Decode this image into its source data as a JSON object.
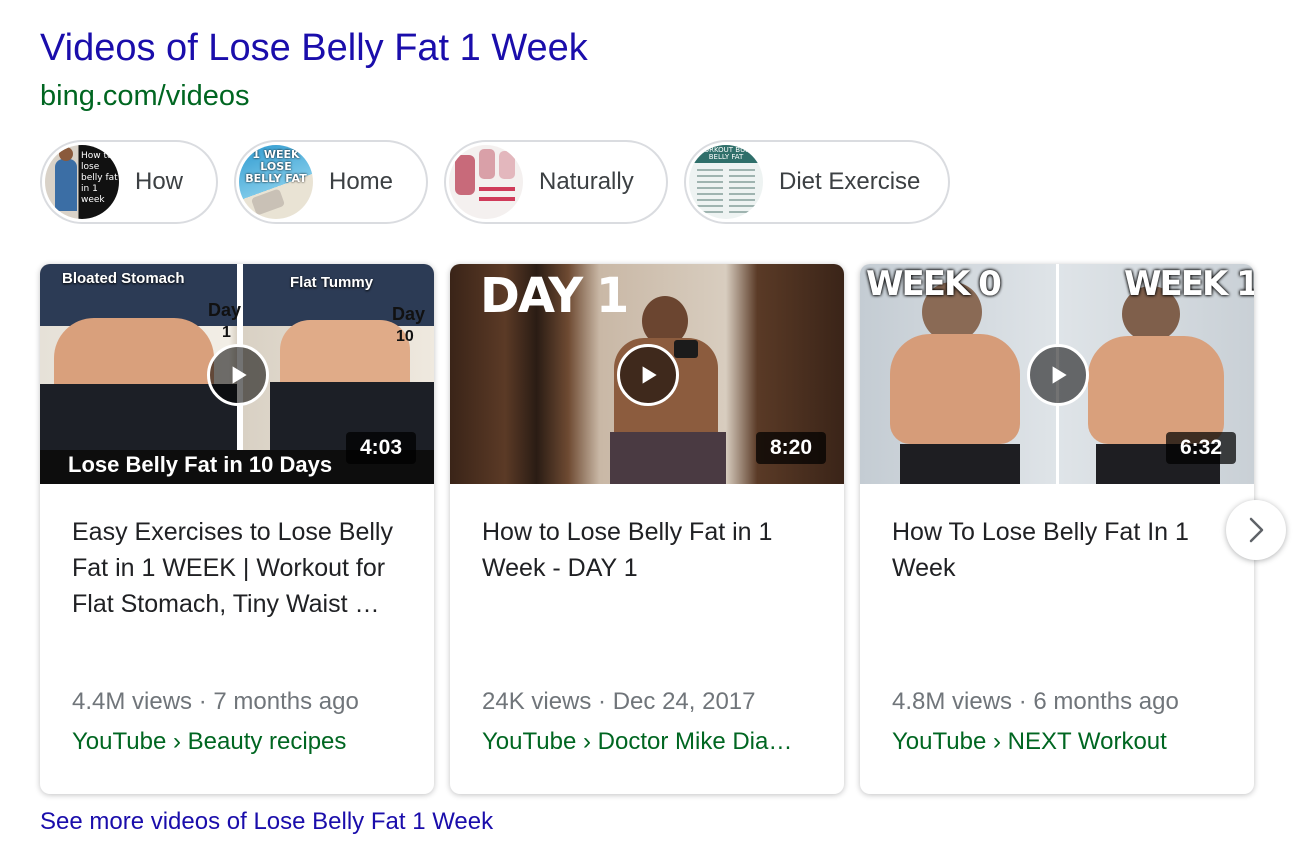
{
  "header": {
    "title": "Videos of Lose Belly Fat 1 Week",
    "source": "bing.com/videos"
  },
  "filters": [
    {
      "label": "How",
      "thumb_text": "How to lose belly fat in 1 week"
    },
    {
      "label": "Home",
      "thumb_text": "1 WEEK LOSE BELLY FAT"
    },
    {
      "label": "Naturally"
    },
    {
      "label": "Diet Exercise",
      "thumb_text": "WORKOUT BURN BELLY FAT"
    }
  ],
  "videos": [
    {
      "title": "Easy Exercises to Lose Belly Fat in 1 WEEK | Workout for Flat Stomach, Tiny Waist …",
      "duration": "4:03",
      "views": "4.4M views",
      "age": "7 months ago",
      "channel": "YouTube › Beauty recipes",
      "overlay": {
        "left_label": "Bloated Stomach",
        "right_label": "Flat Tummy",
        "day_left": "Day",
        "day_left_num": "1",
        "day_right": "Day",
        "day_right_num": "10",
        "banner": "Lose Belly Fat in 10 Days"
      }
    },
    {
      "title": "How to Lose Belly Fat in 1 Week - DAY 1",
      "duration": "8:20",
      "views": "24K views",
      "age": "Dec 24, 2017",
      "channel": "YouTube › Doctor Mike Dia…",
      "overlay": {
        "banner": "DAY 1"
      }
    },
    {
      "title": "How To Lose Belly Fat In 1 Week",
      "duration": "6:32",
      "views": "4.8M views",
      "age": "6 months ago",
      "channel": "YouTube › NEXT Workout",
      "overlay": {
        "left_label": "WEEK 0",
        "right_label": "WEEK 1"
      }
    }
  ],
  "see_more": "See more videos of Lose Belly Fat 1 Week",
  "meta_separator": " · ",
  "colors": {
    "link": "#1a0dab",
    "source": "#006621",
    "meta": "#70757a"
  }
}
